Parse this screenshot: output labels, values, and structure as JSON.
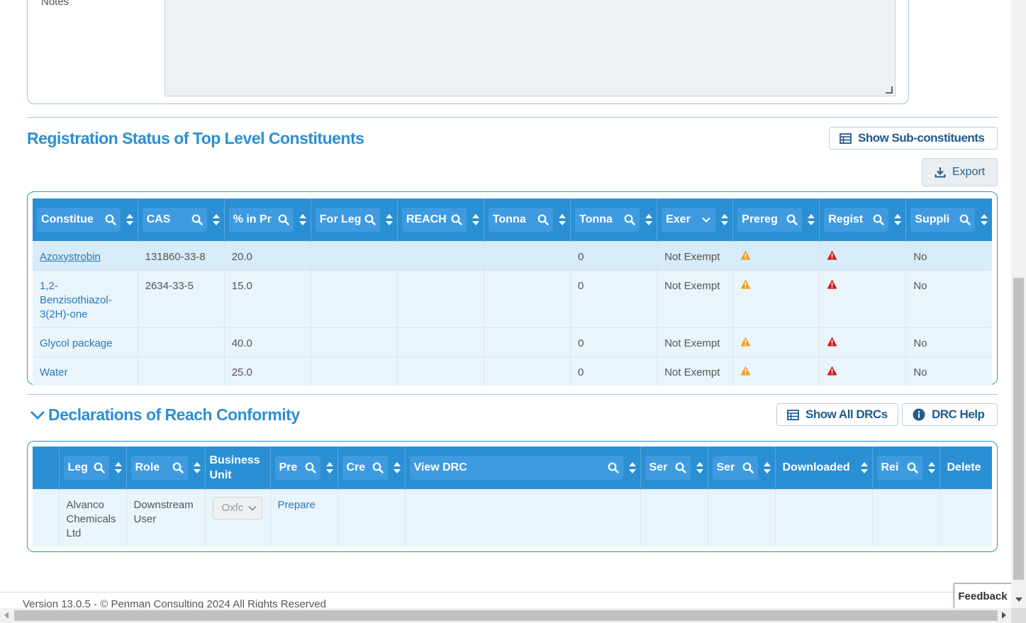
{
  "notes": {
    "label": "Notes"
  },
  "constituents": {
    "title": "Registration Status of Top Level Constituents",
    "show_sub_label": "Show Sub-constituents",
    "export_label": "Export",
    "columns": [
      {
        "label": "Constitue",
        "search": true,
        "dropdown": false
      },
      {
        "label": "CAS",
        "search": true,
        "dropdown": false
      },
      {
        "label": "% in Pr",
        "search": true,
        "dropdown": false
      },
      {
        "label": "For Leg",
        "search": true,
        "dropdown": false
      },
      {
        "label": "REACH",
        "search": true,
        "dropdown": false
      },
      {
        "label": "Tonna",
        "search": true,
        "dropdown": false
      },
      {
        "label": "Tonna",
        "search": true,
        "dropdown": false
      },
      {
        "label": "Exer",
        "search": false,
        "dropdown": true
      },
      {
        "label": "Prereg",
        "search": true,
        "dropdown": false
      },
      {
        "label": "Regist",
        "search": true,
        "dropdown": false
      },
      {
        "label": "Suppli",
        "search": true,
        "dropdown": false
      }
    ],
    "rows": [
      {
        "name": "Azoxystrobin",
        "cas": "131860-33-8",
        "percent": "20.0",
        "for_leg": "",
        "reach": "",
        "tonnage1": "",
        "tonnage2": "0",
        "exempt": "Not Exempt",
        "supplier": "No"
      },
      {
        "name": "1,2-Benzisothiazol-3(2H)-one",
        "cas": "2634-33-5",
        "percent": "15.0",
        "for_leg": "",
        "reach": "",
        "tonnage1": "",
        "tonnage2": "0",
        "exempt": "Not Exempt",
        "supplier": "No"
      },
      {
        "name": "Glycol package",
        "cas": "",
        "percent": "40.0",
        "for_leg": "",
        "reach": "",
        "tonnage1": "",
        "tonnage2": "0",
        "exempt": "Not Exempt",
        "supplier": "No"
      },
      {
        "name": "Water",
        "cas": "",
        "percent": "25.0",
        "for_leg": "",
        "reach": "",
        "tonnage1": "",
        "tonnage2": "0",
        "exempt": "Not Exempt",
        "supplier": "No"
      }
    ],
    "name_lines": [
      [
        "Azoxystrobin"
      ],
      [
        "1,2-",
        "Benzisothiazol-",
        "3(2H)-one"
      ],
      [
        "Glycol package"
      ],
      [
        "Water"
      ]
    ]
  },
  "drc": {
    "title": "Declarations of Reach Conformity",
    "show_all_label": "Show All DRCs",
    "help_label": "DRC Help",
    "columns": {
      "leg": "Leg",
      "role": "Role",
      "business_unit": "Business Unit",
      "pre": "Pre",
      "cre": "Cre",
      "view_drc": "View DRC",
      "ser1": "Ser",
      "ser2": "Ser",
      "downloaded": "Downloaded",
      "rei": "Rei",
      "delete": "Delete"
    },
    "row": {
      "legal_entity": "Alvanco Chemicals Ltd",
      "legal_entity_lines": [
        "Alvanco",
        "Chemicals",
        "Ltd"
      ],
      "role_lines": [
        "Downstream",
        "User"
      ],
      "business_unit_value": "Oxfc",
      "prepare_label": "Prepare"
    }
  },
  "footer": {
    "text": "Version 13.0.5 - © Penman Consulting 2024 All Rights Reserved"
  },
  "feedback": {
    "label": "Feedback"
  },
  "colors": {
    "accent": "#2b8fd4",
    "header_btn": "#3f9be0",
    "warning_orange": "#f0a020",
    "error_red": "#d9161c"
  }
}
